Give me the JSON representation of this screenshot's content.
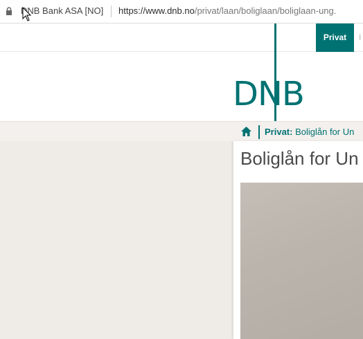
{
  "browser": {
    "site_identity": "DNB Bank ASA [NO]",
    "url_host": "https://www.dnb.no",
    "url_path": "/privat/laan/boliglaan/boliglaan-ung."
  },
  "nav": {
    "privat_tab": "Privat",
    "next_tab": "I"
  },
  "logo": {
    "text": "DNB"
  },
  "breadcrumb": {
    "section": "Privat:",
    "page": " Boliglån for Un"
  },
  "main": {
    "title": "Boliglån for Un"
  },
  "colors": {
    "brand": "#007272"
  }
}
